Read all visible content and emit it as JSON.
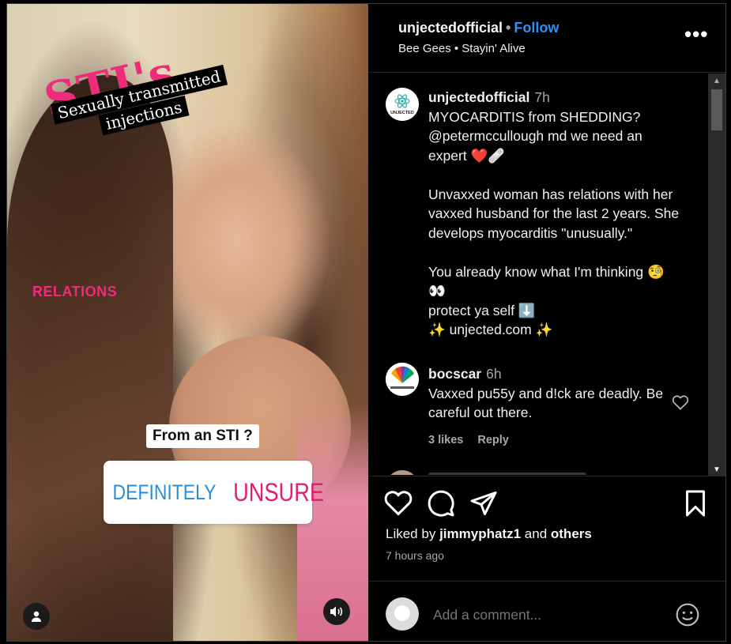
{
  "post": {
    "username": "unjectedofficial",
    "follow_label": "Follow",
    "separator": "•",
    "audio": "Bee Gees • Stayin' Alive",
    "more": "•••"
  },
  "media": {
    "title": "STI's",
    "subtitle_line1": "Sexually transmitted",
    "subtitle_line2": "injections",
    "label": "RELATIONS",
    "poll_question": "From an STI ?",
    "poll_options": [
      "DEFINITELY",
      "UNSURE"
    ],
    "sticker_colors": {
      "pink": "#ee2c7c",
      "blue": "#2a8ed8"
    }
  },
  "caption": {
    "username": "unjectedofficial",
    "time": "7h",
    "avatar_text": "UNJECTED",
    "line1": "MYOCARDITIS from SHEDDING?",
    "line2": "@petermccullough md we need an",
    "line3": "expert ❤️🩹",
    "para2": "Unvaxxed woman has relations with her vaxxed husband for the last 2 years. She develops myocarditis \"unusually.\"",
    "para3_line1": "You already know what I'm thinking 🧐",
    "para3_line2": "👀",
    "para3_line3": "protect ya self ⬇️",
    "para3_line4": "✨ unjected.com ✨"
  },
  "comment1": {
    "username": "bocscar",
    "time": "6h",
    "text": "Vaxxed pu55y and d!ck are deadly. Be careful out there.",
    "likes": "3 likes",
    "reply": "Reply"
  },
  "footer": {
    "liked_prefix": "Liked by",
    "liked_user": "jimmyphatz1",
    "liked_and": "and",
    "liked_others": "others",
    "time_ago": "7 hours ago",
    "add_comment_placeholder": "Add a comment..."
  },
  "colors": {
    "accent_blue": "#2e90f3",
    "heart_red": "#e8203a"
  }
}
